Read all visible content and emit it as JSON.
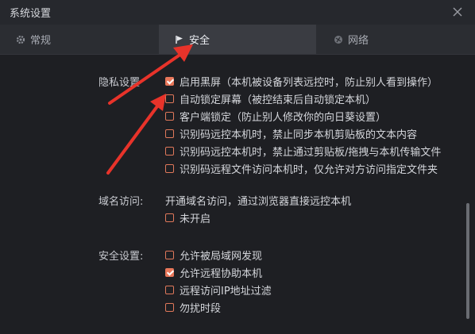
{
  "window": {
    "title": "系统设置"
  },
  "tabs": [
    {
      "label": "常规",
      "icon": "gear-icon"
    },
    {
      "label": "安全",
      "icon": "flag-icon"
    },
    {
      "label": "网络",
      "icon": "globe-icon"
    }
  ],
  "privacy": {
    "label": "隐私设置",
    "options": [
      {
        "label": "启用黑屏（本机被设备列表远控时，防止别人看到操作）",
        "checked": true
      },
      {
        "label": "自动锁定屏幕（被控结束后自动锁定本机）",
        "checked": false
      },
      {
        "label": "客户端锁定（防止别人修改你的向日葵设置）",
        "checked": false
      },
      {
        "label": "识别码远控本机时，禁止同步本机剪贴板的文本内容",
        "checked": false
      },
      {
        "label": "识别码远控本机时，禁止通过剪贴板/拖拽与本机传输文件",
        "checked": false
      },
      {
        "label": "识别码远程文件访问本机时，仅允许对方访问指定文件夹",
        "checked": false
      }
    ]
  },
  "domain": {
    "label": "域名访问:",
    "description": "开通域名访问，通过浏览器直接远控本机",
    "option": {
      "label": "未开启",
      "checked": false
    }
  },
  "security": {
    "label": "安全设置:",
    "options": [
      {
        "label": "允许被局域网发现",
        "checked": false
      },
      {
        "label": "允许远程协助本机",
        "checked": true
      },
      {
        "label": "远程访问IP地址过滤",
        "checked": false
      },
      {
        "label": "勿扰时段",
        "checked": false
      }
    ]
  },
  "colors": {
    "accent": "#e8775a",
    "annotation_arrow": "#e8332a",
    "background": "#1e1f23"
  }
}
